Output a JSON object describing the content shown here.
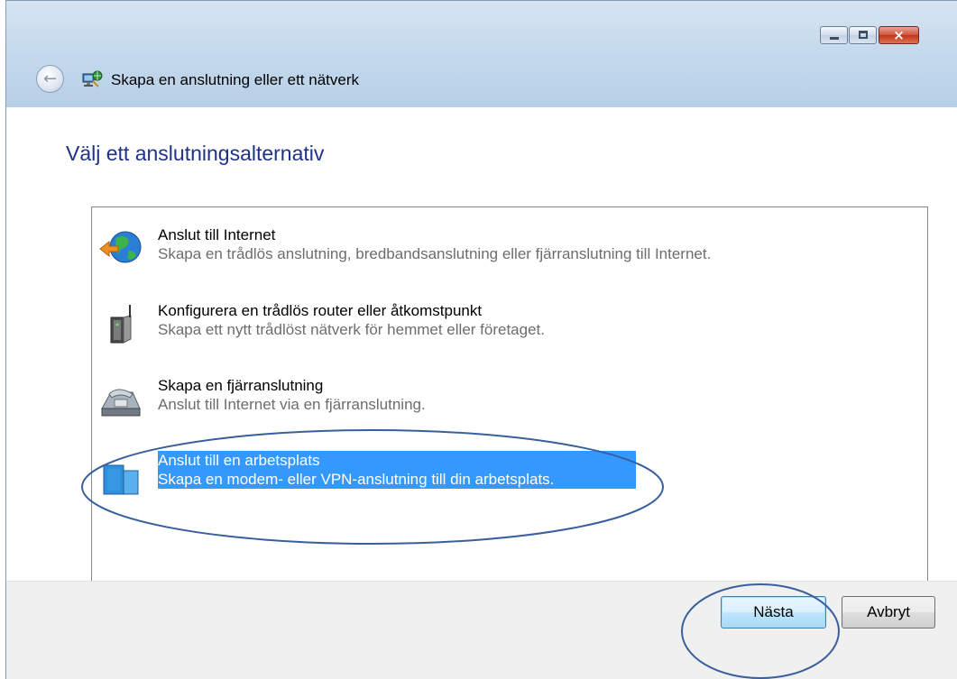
{
  "window": {
    "title": "Skapa en anslutning eller ett nätverk",
    "caption_buttons": {
      "minimize": "minimize",
      "maximize": "maximize",
      "close": "×"
    }
  },
  "page": {
    "heading": "Välj ett anslutningsalternativ"
  },
  "options": [
    {
      "title": "Anslut till Internet",
      "description": "Skapa en trådlös anslutning, bredbandsanslutning eller fjärranslutning till Internet.",
      "icon": "globe-connect-icon",
      "selected": false
    },
    {
      "title": "Konfigurera en trådlös router eller åtkomstpunkt",
      "description": "Skapa ett nytt trådlöst nätverk för hemmet eller företaget.",
      "icon": "router-icon",
      "selected": false
    },
    {
      "title": "Skapa en fjärranslutning",
      "description": "Anslut till Internet via en fjärranslutning.",
      "icon": "telephone-modem-icon",
      "selected": false
    },
    {
      "title": "Anslut till en arbetsplats",
      "description": "Skapa en modem- eller VPN-anslutning till din arbetsplats.",
      "icon": "workplace-building-icon",
      "selected": true
    }
  ],
  "buttons": {
    "next": "Nästa",
    "cancel": "Avbryt"
  },
  "colors": {
    "heading": "#1e3287",
    "selection": "#3399ff",
    "annotation": "#3a5f9e"
  }
}
